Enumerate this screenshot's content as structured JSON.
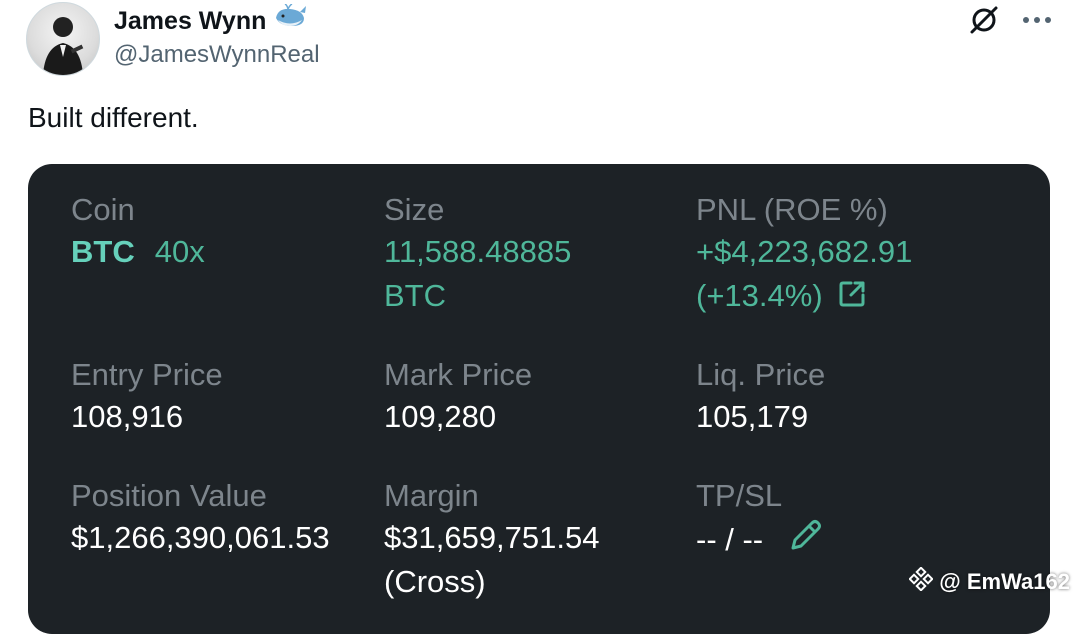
{
  "header": {
    "display_name": "James Wynn",
    "handle": "@JamesWynnReal"
  },
  "tweet": {
    "text": "Built different."
  },
  "position": {
    "coin": {
      "label": "Coin",
      "symbol": "BTC",
      "leverage": "40x"
    },
    "size": {
      "label": "Size",
      "amount": "11,588.48885",
      "unit": "BTC"
    },
    "pnl": {
      "label": "PNL (ROE %)",
      "amount": "+$4,223,682.91",
      "roe": "(+13.4%)"
    },
    "entry_price": {
      "label": "Entry Price",
      "value": "108,916"
    },
    "mark_price": {
      "label": "Mark Price",
      "value": "109,280"
    },
    "liq_price": {
      "label": "Liq. Price",
      "value": "105,179"
    },
    "position_value": {
      "label": "Position Value",
      "value": "$1,266,390,061.53"
    },
    "margin": {
      "label": "Margin",
      "value": "$31,659,751.54",
      "mode": "(Cross)"
    },
    "tp_sl": {
      "label": "TP/SL",
      "value": "-- / --"
    }
  },
  "watermark": {
    "text": "@ EmWa162"
  },
  "colors": {
    "card_bg": "#1d2226",
    "label": "#7d858c",
    "green": "#4fb79a",
    "accent": "#66d1bb"
  },
  "icons": [
    "avatar",
    "whale-emoji-icon",
    "grok-icon",
    "more-icon",
    "external-link-icon",
    "pencil-icon",
    "binance-logo-icon"
  ]
}
